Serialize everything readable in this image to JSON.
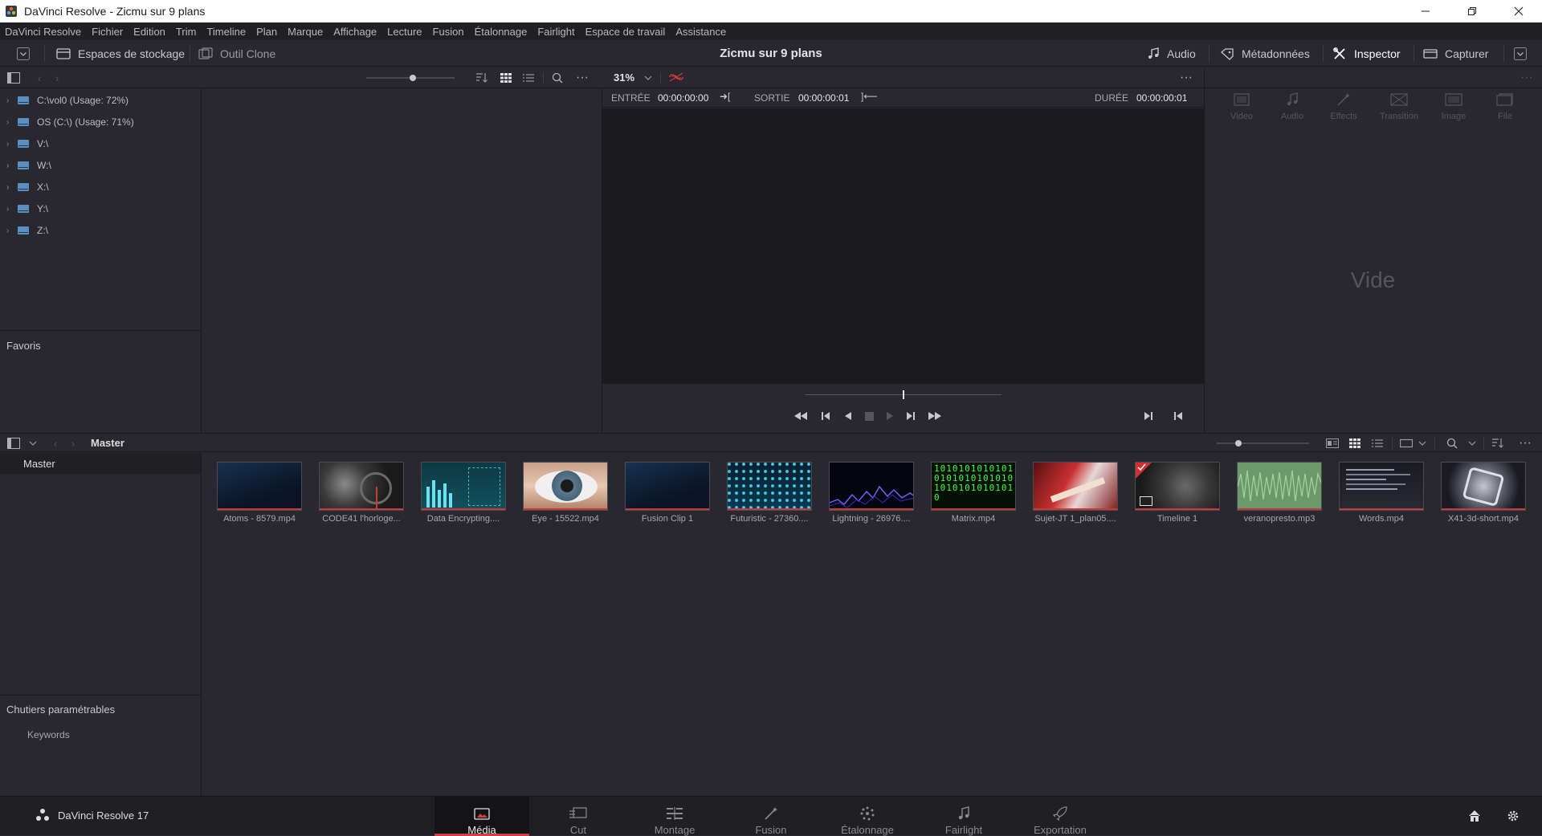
{
  "window": {
    "title": "DaVinci Resolve - Zicmu sur 9 plans"
  },
  "menu": [
    "DaVinci Resolve",
    "Fichier",
    "Edition",
    "Trim",
    "Timeline",
    "Plan",
    "Marque",
    "Affichage",
    "Lecture",
    "Fusion",
    "Étalonnage",
    "Fairlight",
    "Espace de travail",
    "Assistance"
  ],
  "toolbar": {
    "storage_label": "Espaces de stockage",
    "clone_label": "Outil Clone",
    "project_title": "Zicmu sur 9 plans",
    "audio_label": "Audio",
    "metadata_label": "Métadonnées",
    "inspector_label": "Inspector",
    "capture_label": "Capturer"
  },
  "storage": {
    "drives": [
      "C:\\vol0 (Usage: 72%)",
      "OS (C:\\) (Usage: 71%)",
      "V:\\",
      "W:\\",
      "X:\\",
      "Y:\\",
      "Z:\\"
    ],
    "favorites_label": "Favoris"
  },
  "viewer": {
    "zoom": "31%",
    "in_label": "ENTRÉE",
    "in_value": "00:00:00:00",
    "out_label": "SORTIE",
    "out_value": "00:00:00:01",
    "duration_label": "DURÉE",
    "duration_value": "00:00:00:01"
  },
  "inspector": {
    "tabs": [
      "Video",
      "Audio",
      "Effects",
      "Transition",
      "Image",
      "File"
    ],
    "empty_label": "Vide"
  },
  "media_pool": {
    "breadcrumb": "Master",
    "bins": [
      "Master"
    ],
    "smart_bins_label": "Chutiers paramétrables",
    "smart_bins": [
      "Keywords"
    ],
    "clips": [
      {
        "name": "Atoms - 8579.mp4",
        "style": "dark-blue"
      },
      {
        "name": "CODE41 l'horloge...",
        "style": "gray-machine"
      },
      {
        "name": "Data Encrypting....",
        "style": "teal-data"
      },
      {
        "name": "Eye - 15522.mp4",
        "style": "eye"
      },
      {
        "name": "Fusion Clip 1",
        "style": "dark-blue"
      },
      {
        "name": "Futuristic - 27360....",
        "style": "cyan-dots"
      },
      {
        "name": "Lightning - 26976....",
        "style": "lightning"
      },
      {
        "name": "Matrix.mp4",
        "style": "matrix"
      },
      {
        "name": "Sujet-JT 1_plan05....",
        "style": "guitar"
      },
      {
        "name": "Timeline 1",
        "style": "timeline"
      },
      {
        "name": "veranopresto.mp3",
        "style": "audio"
      },
      {
        "name": "Words.mp4",
        "style": "words"
      },
      {
        "name": "X41-3d-short.mp4",
        "style": "mech"
      }
    ]
  },
  "matrix_text": "1010101010101010101010101010101010101010",
  "bottom_nav": {
    "app_label": "DaVinci Resolve 17",
    "tabs": [
      "Média",
      "Cut",
      "Montage",
      "Fusion",
      "Étalonnage",
      "Fairlight",
      "Exportation"
    ],
    "active": "Média"
  }
}
